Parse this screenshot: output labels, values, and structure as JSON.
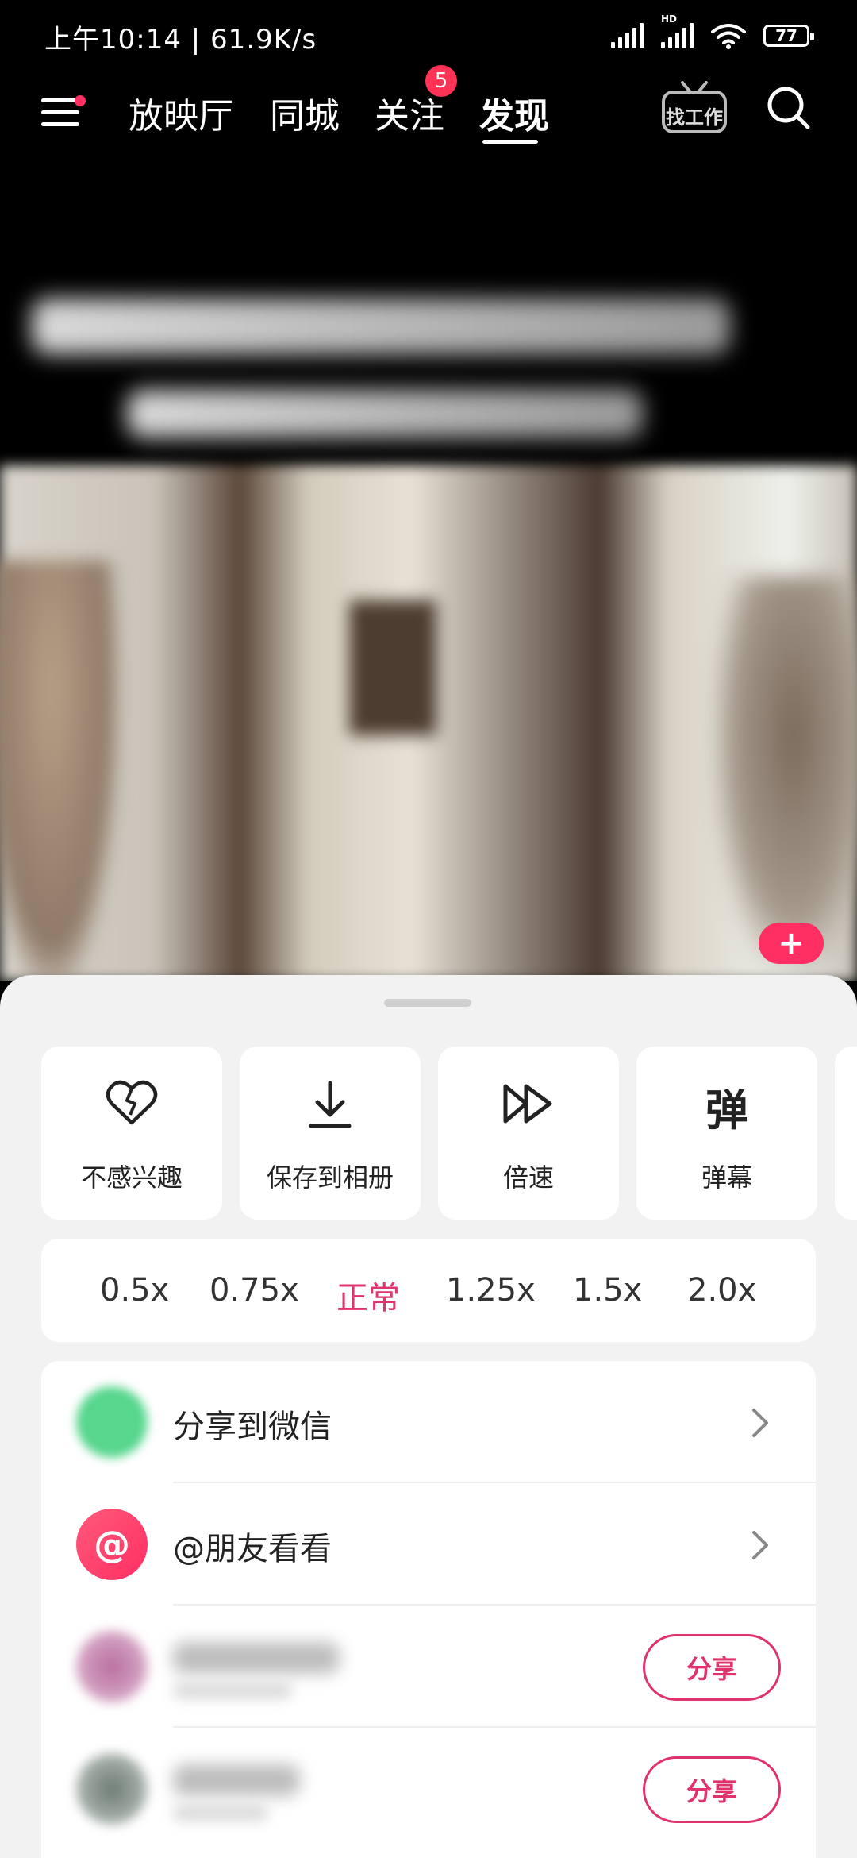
{
  "status_bar": {
    "time_speed": "上午10:14 | 61.9K/s",
    "battery": "77",
    "hd_label": "HD"
  },
  "nav": {
    "tabs": [
      "放映厅",
      "同城",
      "关注",
      "发现"
    ],
    "active_tab": "发现",
    "follow_badge": "5",
    "job_label": "找工作"
  },
  "actions": [
    {
      "label": "不感兴趣",
      "icon": "broken-heart-icon"
    },
    {
      "label": "保存到相册",
      "icon": "download-icon"
    },
    {
      "label": "倍速",
      "icon": "fast-forward-icon"
    },
    {
      "label": "弹幕",
      "icon": "danmaku-icon",
      "icon_char": "弹"
    }
  ],
  "speeds": {
    "options": [
      "0.5x",
      "0.75x",
      "正常",
      "1.25x",
      "1.5x",
      "2.0x"
    ],
    "selected": "正常"
  },
  "share_list": {
    "wechat_label": "分享到微信",
    "friends_label": "@朋友看看",
    "friends_icon_char": "@",
    "share_button_label": "分享"
  },
  "colors": {
    "accent": "#e0336b",
    "badge": "#ff3355",
    "wechat_green": "#57d68d"
  }
}
